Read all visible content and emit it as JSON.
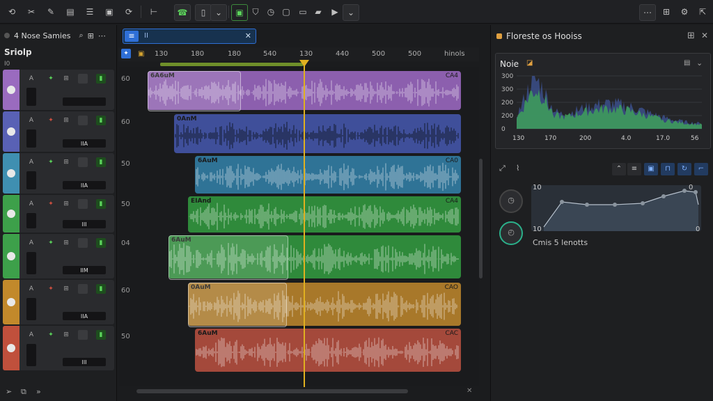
{
  "toolbar": {
    "left_icons": [
      "undo-icon",
      "scissors-icon",
      "pencil-icon",
      "document-icon",
      "mixer-icon",
      "image-icon",
      "redo-icon",
      "split-icon",
      "phone-icon",
      "save-icon",
      "chevron-down-icon",
      "record-icon",
      "shield-icon",
      "clock-icon",
      "window-icon",
      "folder-icon",
      "play-icon",
      "chevron-down-icon"
    ],
    "right_icons": [
      "ellipsis-icon",
      "grid-icon",
      "settings-icon",
      "export-icon"
    ]
  },
  "browser": {
    "title": "4 Nose Samies",
    "section": "Sriolp",
    "col_label": "I0"
  },
  "search": {
    "value": "II"
  },
  "ruler": {
    "ticks": [
      "130",
      "180",
      "180",
      "540",
      "130",
      "440",
      "500",
      "500"
    ],
    "end_label": "hinols"
  },
  "tracks": [
    {
      "num": "60",
      "color": "#9a6bbf",
      "clip_color": "#8c5fae",
      "clip_label": "6A6uM",
      "clip_end": "CA4",
      "pill": ""
    },
    {
      "num": "60",
      "color": "#5961b5",
      "clip_color": "#3f4f9a",
      "clip_label": "0AnM",
      "clip_end": "",
      "pill": "IIA"
    },
    {
      "num": "50",
      "color": "#3f8fb1",
      "clip_color": "#2f7396",
      "clip_label": "6AuM",
      "clip_end": "CA0",
      "pill": "IIA"
    },
    {
      "num": "50",
      "color": "#3da04a",
      "clip_color": "#2f8a3b",
      "clip_label": "EIAnd",
      "clip_end": "CA4",
      "pill": "III"
    },
    {
      "num": "04",
      "color": "#3da04a",
      "clip_color": "#2f8a3b",
      "clip_label": "6AuM",
      "clip_end": "",
      "pill": "IIM"
    },
    {
      "num": "60",
      "color": "#c2892b",
      "clip_color": "#a8782a",
      "clip_label": "0AuM",
      "clip_end": "CAO",
      "pill": "IIA"
    },
    {
      "num": "50",
      "color": "#c0503c",
      "clip_color": "#a4493b",
      "clip_label": "6AuM",
      "clip_end": "CAC",
      "pill": "III"
    }
  ],
  "inspector": {
    "title": "Floreste os Hooiss",
    "noise_label": "Noie",
    "spectrum_yticks": [
      "300",
      "300",
      "200",
      "200",
      "0"
    ],
    "spectrum_xticks": [
      "130",
      "170",
      "200",
      "4.0",
      "17.0",
      "56"
    ],
    "env_top_left": "10",
    "env_bottom_left": "10",
    "env_top_right": "0",
    "env_bottom_right": "0",
    "caption": "Cmis 5 lenotts"
  },
  "colors": {
    "accent": "#2f6fd6",
    "playhead": "#e0b020",
    "ok": "#5bd35b"
  }
}
